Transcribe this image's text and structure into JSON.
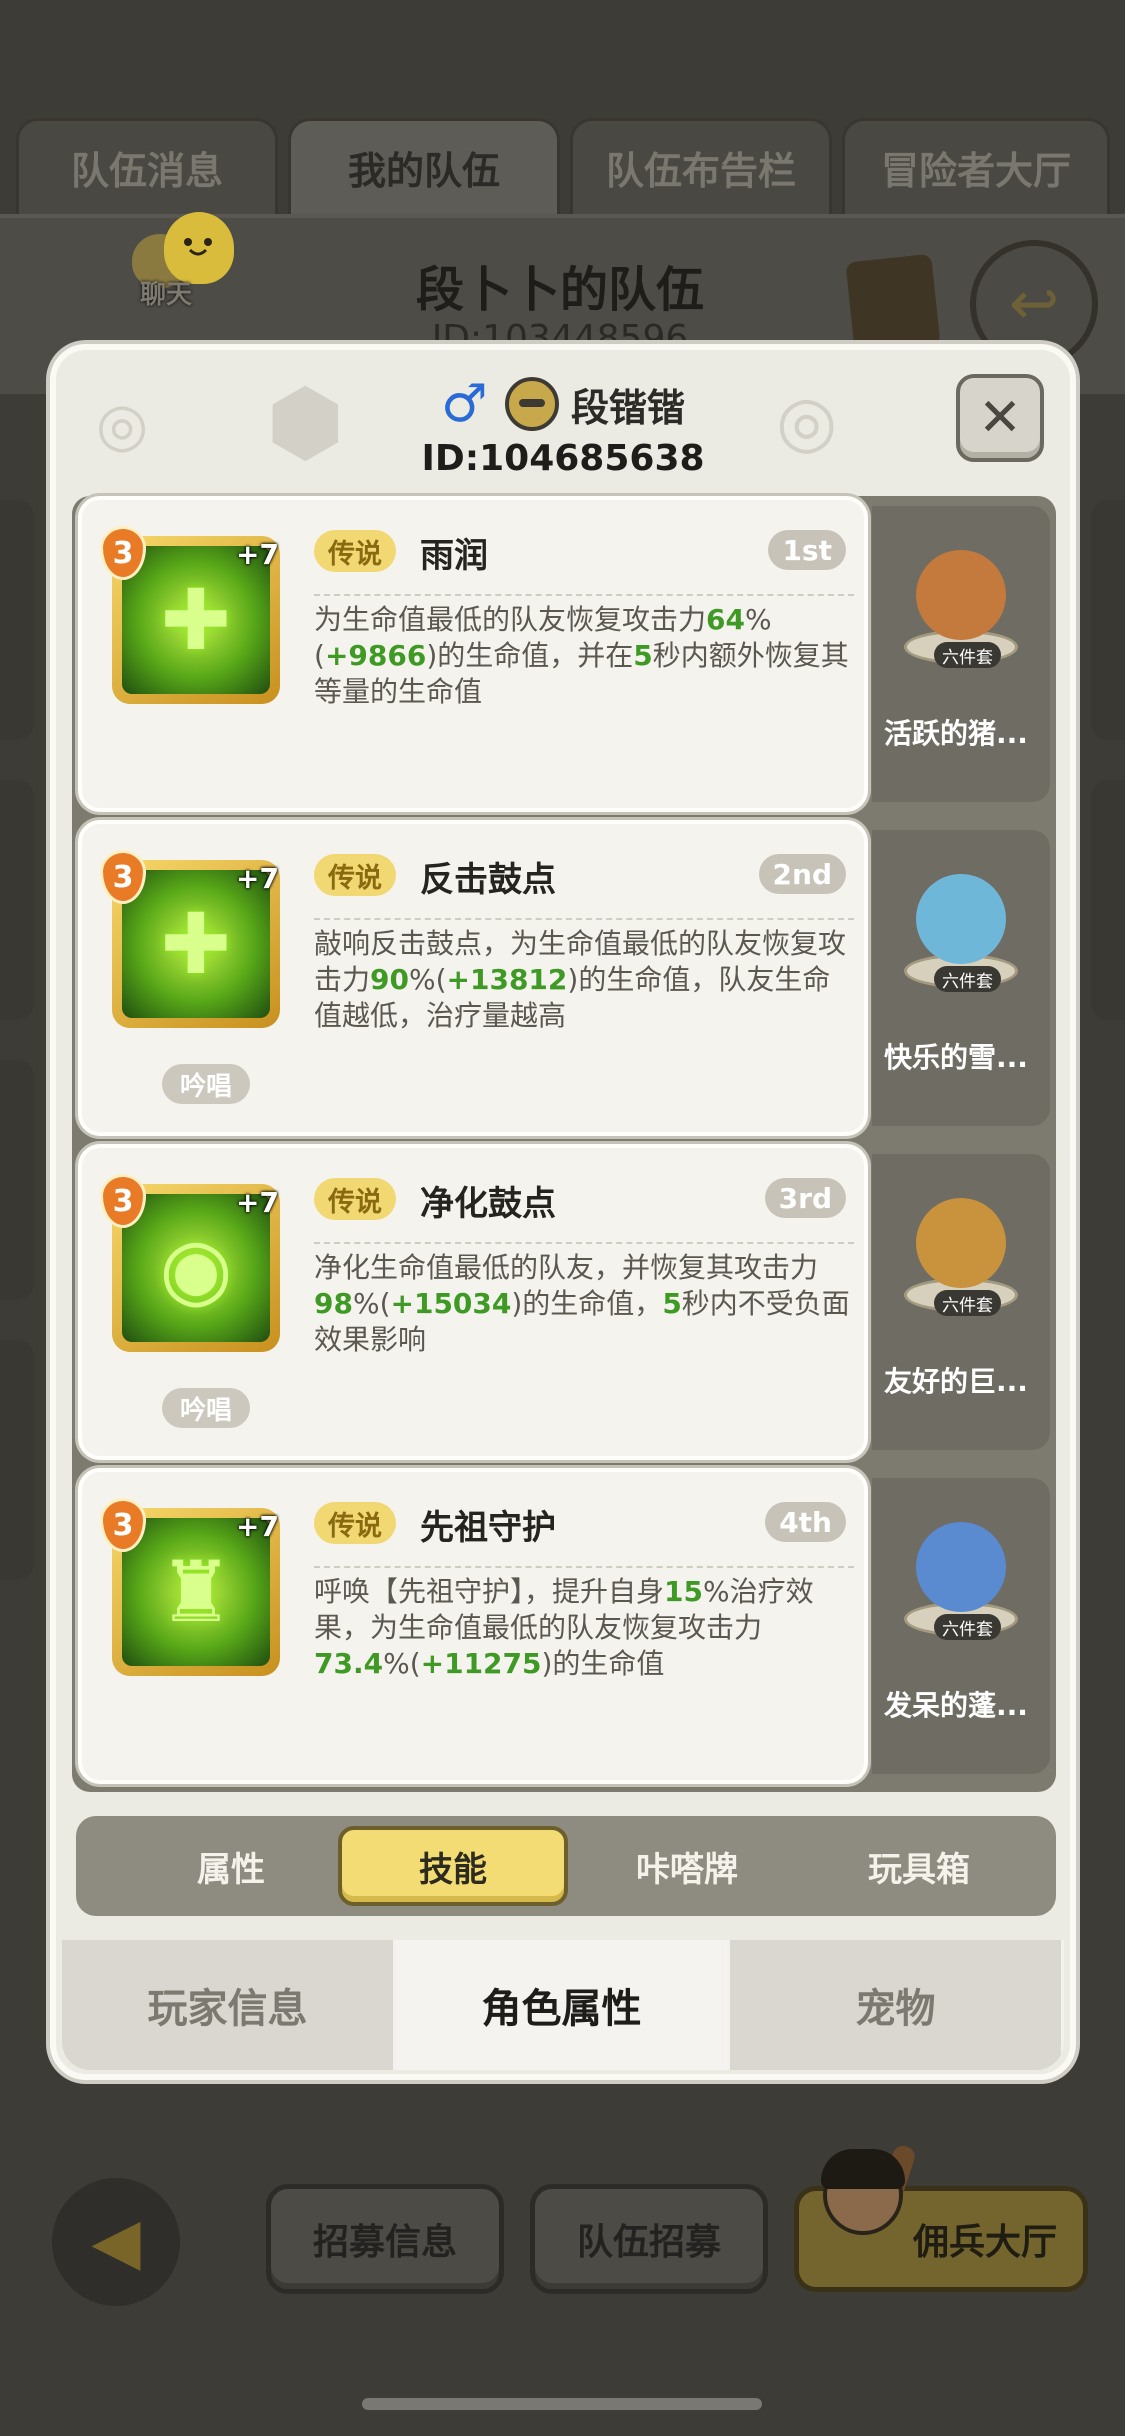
{
  "background": {
    "tabs": [
      "队伍消息",
      "我的队伍",
      "队伍布告栏",
      "冒险者大厅"
    ],
    "active_tab": 1,
    "team_title": "段卜卜的队伍",
    "team_id": "ID:103448596",
    "chat_label": "聊天"
  },
  "player": {
    "gender_icon": "male-symbol",
    "name": "段锴锴",
    "id": "ID:104685638"
  },
  "skills": [
    {
      "level": "3",
      "plus": "+7",
      "rarity": "传说",
      "name": "雨润",
      "rank": "1st",
      "chant": "",
      "desc": [
        {
          "t": "为生命值最低的队友恢复攻击力",
          "h": false
        },
        {
          "t": "64",
          "h": true
        },
        {
          "t": "%(",
          "h": false
        },
        {
          "t": "+9866",
          "h": true
        },
        {
          "t": ")的生命值，并在",
          "h": false
        },
        {
          "t": "5",
          "h": true
        },
        {
          "t": "秒内额外恢复其等量的生命值",
          "h": false
        }
      ],
      "glyph": "✚",
      "pet": {
        "name": "活跃的猪...",
        "set": "六件套",
        "color": "#c47a3c"
      }
    },
    {
      "level": "3",
      "plus": "+7",
      "rarity": "传说",
      "name": "反击鼓点",
      "rank": "2nd",
      "chant": "吟唱",
      "desc": [
        {
          "t": "敲响反击鼓点，为生命值最低的队友恢复攻击力",
          "h": false
        },
        {
          "t": "90",
          "h": true
        },
        {
          "t": "%(",
          "h": false
        },
        {
          "t": "+13812",
          "h": true
        },
        {
          "t": ")的生命值，队友生命值越低，治疗量越高",
          "h": false
        }
      ],
      "glyph": "✚",
      "pet": {
        "name": "快乐的雪...",
        "set": "六件套",
        "color": "#6fb7d9"
      }
    },
    {
      "level": "3",
      "plus": "+7",
      "rarity": "传说",
      "name": "净化鼓点",
      "rank": "3rd",
      "chant": "吟唱",
      "desc": [
        {
          "t": "净化生命值最低的队友，并恢复其攻击力",
          "h": false
        },
        {
          "t": "98",
          "h": true
        },
        {
          "t": "%(",
          "h": false
        },
        {
          "t": "+15034",
          "h": true
        },
        {
          "t": ")的生命值，",
          "h": false
        },
        {
          "t": "5",
          "h": true
        },
        {
          "t": "秒内不受负面效果影响",
          "h": false
        }
      ],
      "glyph": "◉",
      "pet": {
        "name": "友好的巨...",
        "set": "六件套",
        "color": "#c9923c"
      }
    },
    {
      "level": "3",
      "plus": "+7",
      "rarity": "传说",
      "name": "先祖守护",
      "rank": "4th",
      "chant": "",
      "desc": [
        {
          "t": "呼唤【先祖守护】，提升自身",
          "h": false
        },
        {
          "t": "15",
          "h": true
        },
        {
          "t": "%治疗效果，为生命值最低的队友恢复攻击力",
          "h": false
        },
        {
          "t": "73.4",
          "h": true
        },
        {
          "t": "%(",
          "h": false
        },
        {
          "t": "+11275",
          "h": true
        },
        {
          "t": ")的生命值",
          "h": false
        }
      ],
      "glyph": "♜",
      "pet": {
        "name": "发呆的蓬...",
        "set": "六件套",
        "color": "#5a8ad0"
      }
    }
  ],
  "sub_tabs": [
    "属性",
    "技能",
    "咔嗒牌",
    "玩具箱"
  ],
  "active_sub_tab": 1,
  "bottom_tabs": [
    "玩家信息",
    "角色属性",
    "宠物"
  ],
  "active_bottom_tab": 1,
  "bottom_bar": {
    "recruit_info": "招募信息",
    "team_recruit": "队伍招募",
    "mercenary_hall": "佣兵大厅"
  },
  "colors": {
    "highlight_green": "#3e9a25",
    "rarity_gold": "#f2d872",
    "active_tab_yellow": "#f3dc73"
  }
}
